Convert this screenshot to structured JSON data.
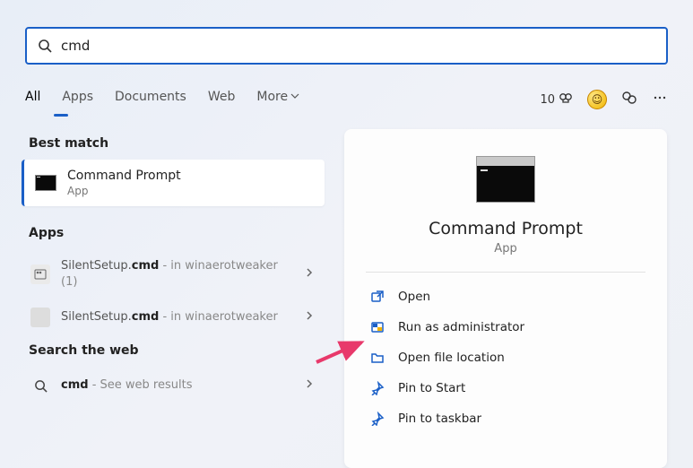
{
  "search": {
    "value": "cmd"
  },
  "tabs": {
    "all": "All",
    "apps": "Apps",
    "documents": "Documents",
    "web": "Web",
    "more": "More"
  },
  "rewards": {
    "points": "10"
  },
  "sections": {
    "best_match": "Best match",
    "apps": "Apps",
    "search_web": "Search the web"
  },
  "best": {
    "title": "Command Prompt",
    "subtitle": "App"
  },
  "apps_results": [
    {
      "name_a": "SilentSetup.",
      "name_b": "cmd",
      "suffix": " - in winaerotweaker (1)"
    },
    {
      "name_a": "SilentSetup.",
      "name_b": "cmd",
      "suffix": " - in winaerotweaker"
    }
  ],
  "web_result": {
    "prefix": "cmd",
    "suffix": " - See web results"
  },
  "panel": {
    "title": "Command Prompt",
    "subtitle": "App",
    "actions": {
      "open": "Open",
      "admin": "Run as administrator",
      "location": "Open file location",
      "pin_start": "Pin to Start",
      "pin_taskbar": "Pin to taskbar"
    }
  }
}
